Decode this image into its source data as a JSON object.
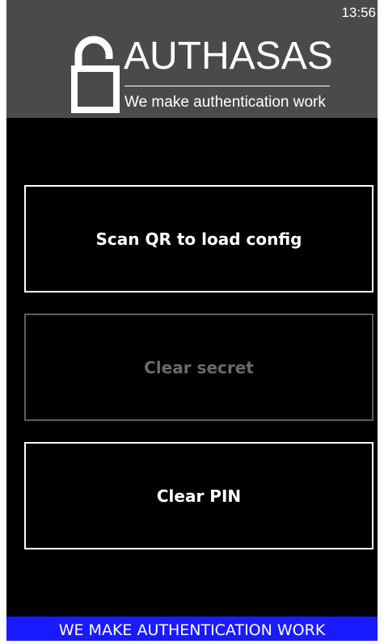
{
  "status_bar": {
    "time": "13:56"
  },
  "header": {
    "brand_name": "AUTHASAS",
    "tagline": "We make authentication work",
    "logo_icon": "padlock-icon"
  },
  "buttons": {
    "scan_qr": {
      "label": "Scan QR to load config",
      "enabled": true
    },
    "clear_secret": {
      "label": "Clear secret",
      "enabled": false
    },
    "clear_pin": {
      "label": "Clear PIN",
      "enabled": true
    }
  },
  "footer": {
    "banner_text": "WE MAKE AUTHENTICATION WORK"
  },
  "colors": {
    "header_bg": "#4a4a4a",
    "app_bg": "#000000",
    "footer_bg": "#1a1aff",
    "disabled": "#6a6a6a"
  }
}
